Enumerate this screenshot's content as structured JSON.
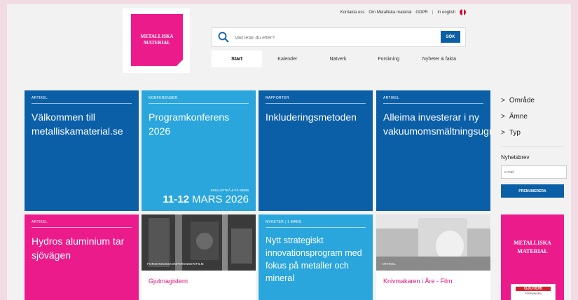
{
  "topbar": {
    "contact": "Kontakta oss",
    "about": "Om Metalliska material",
    "gdpr": "GDPR",
    "separator": "|",
    "english": "In english"
  },
  "logo": {
    "line1": "METALLISKA",
    "line2": "MATERIAL"
  },
  "search": {
    "placeholder": "Vad letar du efter?",
    "button": "SÖK"
  },
  "nav": {
    "items": [
      "Start",
      "Kalender",
      "Nätverk",
      "Forskning",
      "Nyheter & fakta"
    ],
    "active": "Start"
  },
  "tiles": [
    {
      "tag": "ARTIKEL",
      "title": "Välkommen till metalliskamaterial.se"
    },
    {
      "tag": "KONFERENSER",
      "title": "Programkonferens 2026",
      "date_caption": "SKELLEFTEÅ & PÅ WEBB",
      "date_bold": "11-12",
      "date_rest": "MARS 2026"
    },
    {
      "tag": "RAPPORTER",
      "title": "Inkluderingsmetoden"
    },
    {
      "tag": "ARTIKEL",
      "title": "Alleima investerar i ny vakuumomsmältningsugn"
    },
    {
      "tag": "ARTIKEL",
      "title": "Hydros aluminium tar sjövägen"
    },
    {
      "tag": "FORSKNINGSKONFERENSER/FILM",
      "caption": "Gjutmagistern"
    },
    {
      "tag": "NYHETER | 1 MARS",
      "title": "Nytt strategiskt innovationsprogram med fokus på metaller och mineral"
    },
    {
      "tag": "ARTIKEL",
      "caption": "Knivmakaren i Åre - Film"
    }
  ],
  "sidebar": {
    "filters": [
      "Område",
      "Ämne",
      "Typ"
    ],
    "newsletter_label": "Nyhetsbrev",
    "email_placeholder": "e-mail",
    "subscribe": "PRENUMERERA"
  },
  "ad": {
    "line1": "METALLISKA",
    "line2": "MATERIAL",
    "partner": "GJUTERI",
    "partner_sub": "FÖRENINGEN"
  },
  "colors": {
    "blue": "#0b5fa7",
    "cyan": "#2aa6dd",
    "pink": "#ec1b8c"
  },
  "icons": {
    "search": "search-icon",
    "flag": "uk-flag-icon",
    "filter": "chevron-right-icon"
  }
}
